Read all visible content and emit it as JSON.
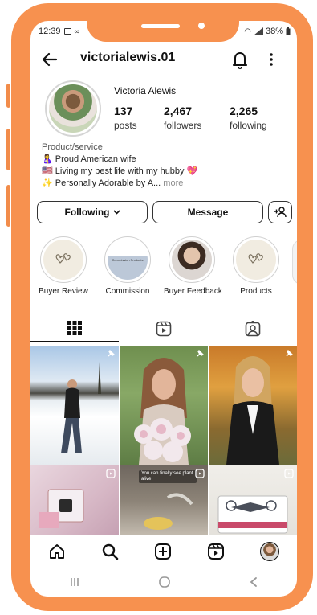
{
  "status_bar": {
    "time": "12:39",
    "battery": "38%"
  },
  "header": {
    "username": "victorialewis.01"
  },
  "profile": {
    "full_name": "Victoria Alewis",
    "stats": [
      {
        "value": "137",
        "label": "posts"
      },
      {
        "value": "2,467",
        "label": "followers"
      },
      {
        "value": "2,265",
        "label": "following"
      }
    ],
    "bio": {
      "category": "Product/service",
      "line1": "🤱 Proud American wife",
      "line2": "🇺🇸 Living my best life with my hubby 💖",
      "line3": "✨ Personally Adorable by A...",
      "more": "more"
    }
  },
  "actions": {
    "following_label": "Following",
    "message_label": "Message"
  },
  "highlights": [
    {
      "label": "Buyer Review"
    },
    {
      "label": "Commission"
    },
    {
      "label": "Buyer Feedback"
    },
    {
      "label": "Products"
    }
  ],
  "highlight_commission_text": "Commission Products",
  "grid_post_caption": "You can finally see plant alive",
  "colors": {
    "phone_frame": "#f7914f",
    "accent_border": "#333333"
  }
}
